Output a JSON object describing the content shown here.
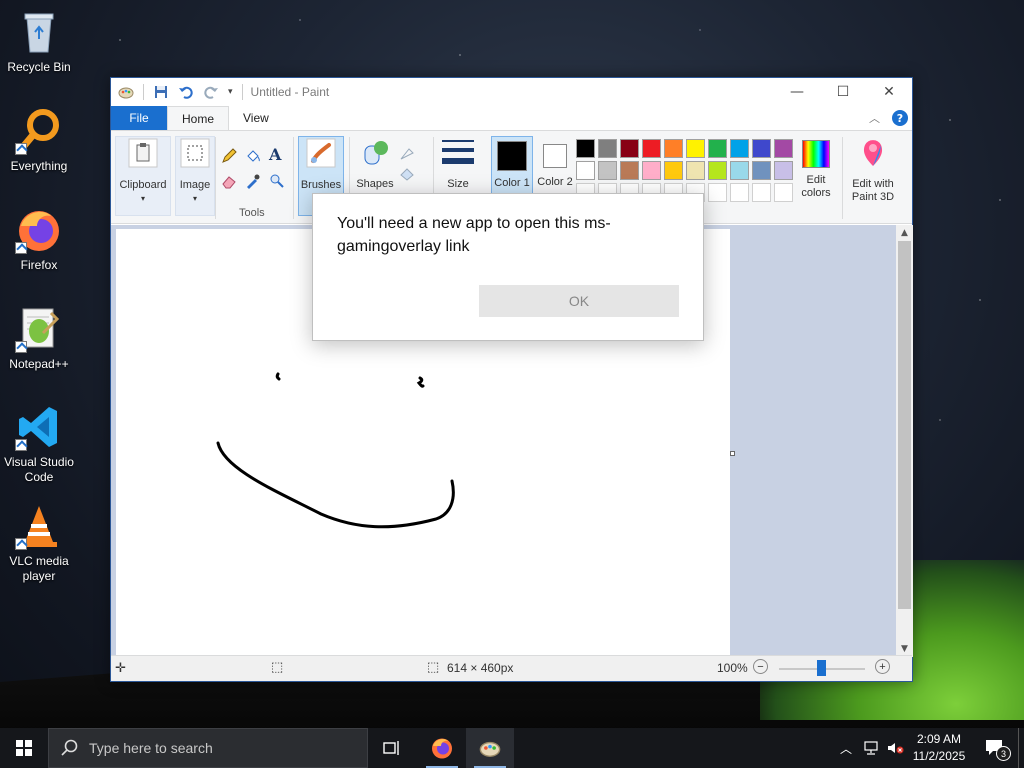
{
  "desktop": {
    "icons": [
      {
        "label": "Recycle Bin"
      },
      {
        "label": "Everything"
      },
      {
        "label": "Firefox"
      },
      {
        "label": "Notepad++"
      },
      {
        "label": "Visual Studio Code"
      },
      {
        "label": "VLC media player"
      }
    ]
  },
  "window": {
    "title": "Untitled - Paint",
    "tabs": {
      "file": "File",
      "home": "Home",
      "view": "View"
    },
    "ribbon": {
      "clipboard": "Clipboard",
      "image": "Image",
      "tools": "Tools",
      "brushes": "Brushes",
      "shapes": "Shapes",
      "size": "Size",
      "color1": "Color 1",
      "color2": "Color 2",
      "edit_colors": "Edit colors",
      "paint3d": "Edit with Paint 3D"
    },
    "palette_row1": [
      "#000000",
      "#7f7f7f",
      "#880015",
      "#ed1c24",
      "#ff7f27",
      "#fff200",
      "#22b14c",
      "#00a2e8",
      "#3f48cc",
      "#a349a4"
    ],
    "palette_row2": [
      "#ffffff",
      "#c3c3c3",
      "#b97a57",
      "#ffaec9",
      "#ffc90e",
      "#efe4b0",
      "#b5e61d",
      "#99d9ea",
      "#7092be",
      "#c8bfe7"
    ],
    "status": {
      "dimensions": "614 × 460px",
      "zoom": "100%"
    }
  },
  "dialog": {
    "message": "You'll need a new app to open this ms-gamingoverlay link",
    "ok": "OK"
  },
  "taskbar": {
    "search_placeholder": "Type here to search",
    "time": "2:09 AM",
    "date": "11/2/2025",
    "notifications": "3"
  }
}
